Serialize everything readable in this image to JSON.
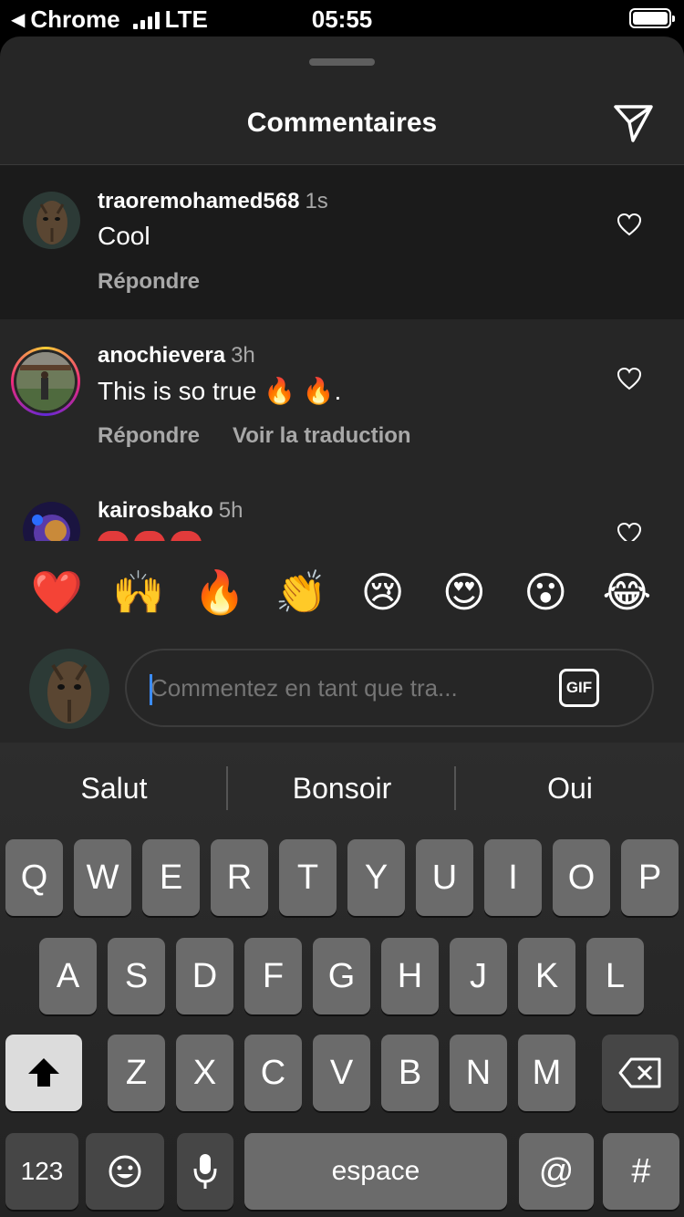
{
  "status_bar": {
    "back_app": "Chrome",
    "network": "LTE",
    "time": "05:55"
  },
  "sheet": {
    "title": "Commentaires"
  },
  "comments": [
    {
      "username": "traoremohamed568",
      "time": "1s",
      "text": "Cool",
      "reply_label": "Répondre"
    },
    {
      "username": "anochievera",
      "time": "3h",
      "text": "This is so true 🔥 🔥.",
      "reply_label": "Répondre",
      "translate_label": "Voir la traduction"
    },
    {
      "username": "kairosbako",
      "time": "5h"
    }
  ],
  "emoji_bar": [
    "❤️",
    "🙌",
    "🔥",
    "👏",
    "😢",
    "😍",
    "😮",
    "😂"
  ],
  "comment_input": {
    "placeholder": "Commentez en tant que tra...",
    "gif_label": "GIF"
  },
  "keyboard": {
    "suggestions": [
      "Salut",
      "Bonsoir",
      "Oui"
    ],
    "row1": [
      "Q",
      "W",
      "E",
      "R",
      "T",
      "Y",
      "U",
      "I",
      "O",
      "P"
    ],
    "row2": [
      "A",
      "S",
      "D",
      "F",
      "G",
      "H",
      "J",
      "K",
      "L"
    ],
    "row3": [
      "Z",
      "X",
      "C",
      "V",
      "B",
      "N",
      "M"
    ],
    "numbers_label": "123",
    "space_label": "espace",
    "at_label": "@",
    "hash_label": "#"
  }
}
